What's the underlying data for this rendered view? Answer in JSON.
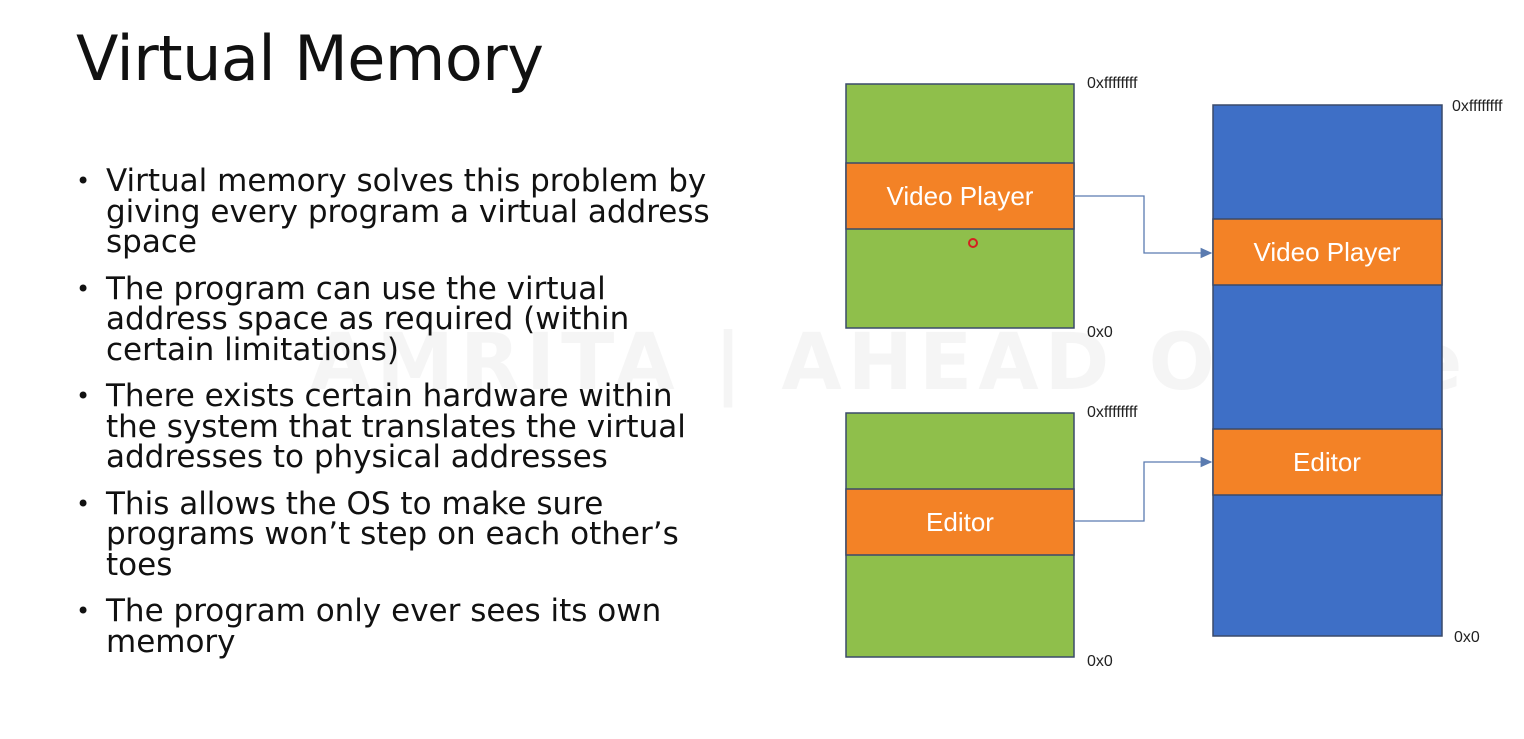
{
  "slide": {
    "title": "Virtual Memory",
    "bullets": [
      "Virtual memory solves this problem by giving every program a virtual address space",
      "The program can use the virtual address space as required (within certain limitations)",
      "There exists certain hardware within the system that translates the virtual addresses to physical addresses",
      "This allows the OS to make sure programs won’t step on each other’s toes",
      "The program only ever sees its own memory"
    ],
    "watermark": "AMRITA | AHEAD Online"
  },
  "diagram": {
    "colors": {
      "virtual_space": "#8fbf4b",
      "physical_space": "#3e6fc6",
      "program_block": "#f38226",
      "border": "#3a4a6a",
      "arrow": "#5a7bb0"
    },
    "video_player_space": {
      "top_address": "0xffffffff",
      "bottom_address": "0x0",
      "block_label": "Video Player"
    },
    "editor_space": {
      "top_address": "0xffffffff",
      "bottom_address": "0x0",
      "block_label": "Editor"
    },
    "physical_space": {
      "top_address": "0xffffffff",
      "bottom_address": "0x0",
      "blocks": [
        "Video Player",
        "Editor"
      ]
    }
  }
}
